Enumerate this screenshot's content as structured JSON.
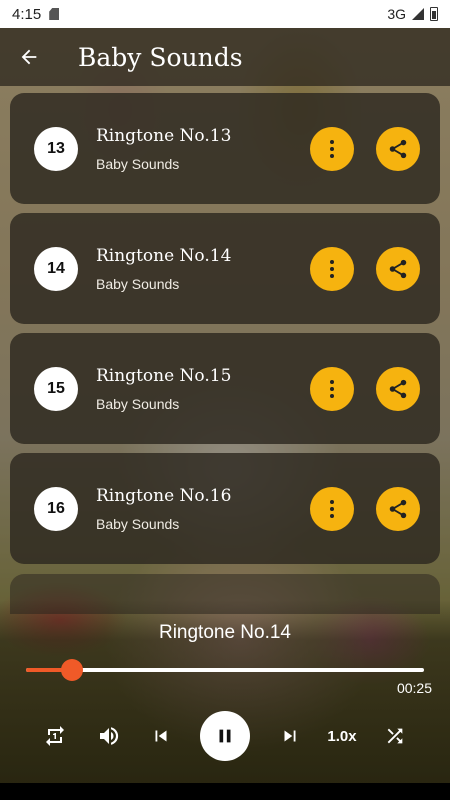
{
  "status": {
    "time": "4:15",
    "network": "3G"
  },
  "app_bar": {
    "title": "Baby Sounds"
  },
  "list": {
    "items": [
      {
        "number": "13",
        "title": "Ringtone No.13",
        "subtitle": "Baby Sounds"
      },
      {
        "number": "14",
        "title": "Ringtone No.14",
        "subtitle": "Baby Sounds"
      },
      {
        "number": "15",
        "title": "Ringtone No.15",
        "subtitle": "Baby Sounds"
      },
      {
        "number": "16",
        "title": "Ringtone No.16",
        "subtitle": "Baby Sounds"
      }
    ]
  },
  "player": {
    "now_playing": "Ringtone No.14",
    "duration": "00:25",
    "progress": 0.115,
    "speed": "1.0x"
  },
  "icons": {
    "back": "arrow-back-icon",
    "more": "more-vertical-icon",
    "share": "share-icon",
    "repeat": "repeat-one-icon",
    "volume": "volume-icon",
    "previous": "skip-previous-icon",
    "pause": "pause-icon",
    "next": "skip-next-icon",
    "shuffle": "shuffle-icon"
  },
  "colors": {
    "accent": "#f6b30f",
    "progress": "#f05a28"
  }
}
